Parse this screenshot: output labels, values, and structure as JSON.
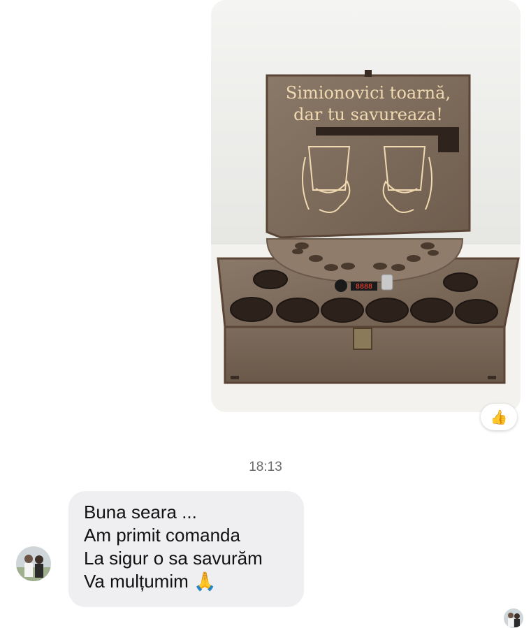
{
  "image_message": {
    "engraving_line1": "Simionovici toarnă,",
    "engraving_line2": "dar tu savureaza!",
    "counter_display": "8888"
  },
  "reaction": {
    "emoji": "👍"
  },
  "timestamp": "18:13",
  "incoming_message": {
    "lines": [
      "Buna seara ...",
      "Am primit comanda",
      "La sigur o sa savurăm",
      "Va mulțumim 🙏"
    ]
  }
}
